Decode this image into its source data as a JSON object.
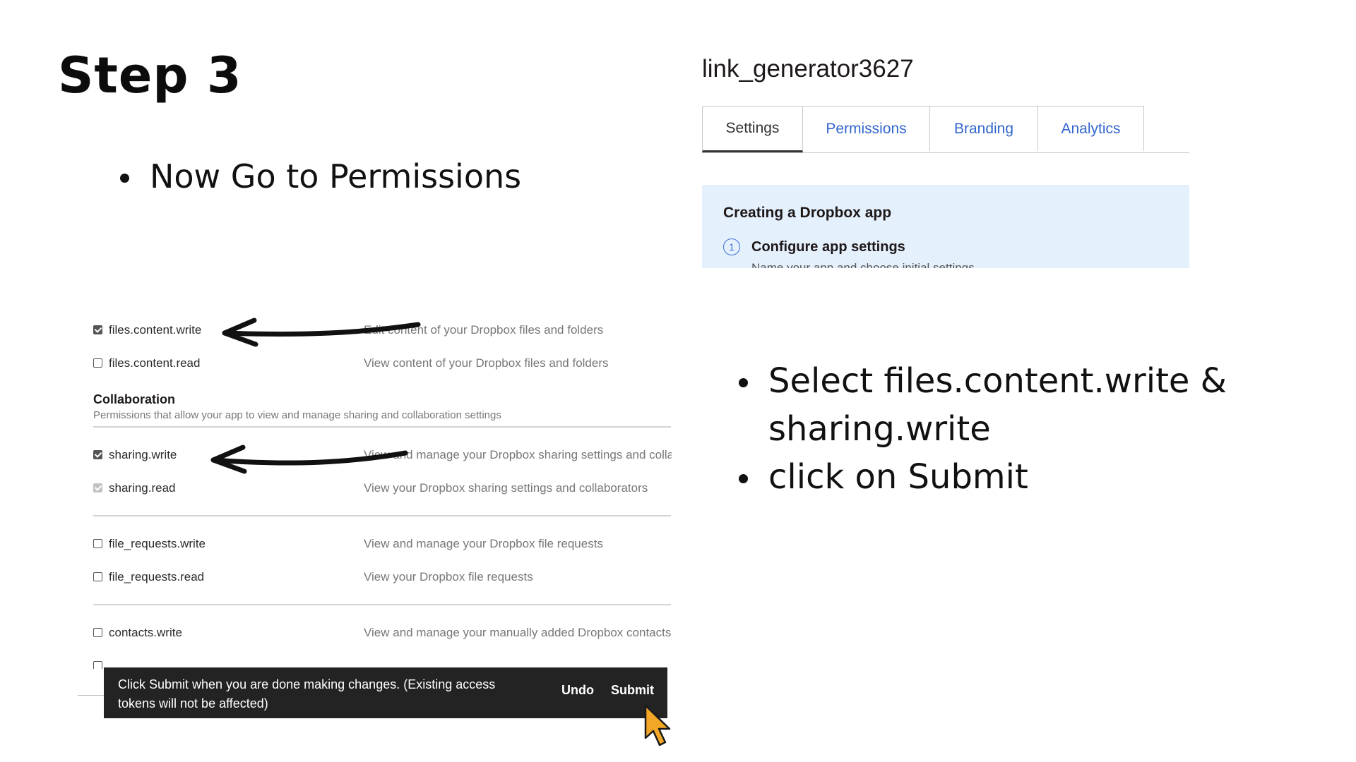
{
  "slide": {
    "title": "Step 3",
    "bullets_left": [
      "Now Go to Permissions"
    ],
    "bullets_right": [
      "Select files.content.write & sharing.write",
      "click on Submit"
    ]
  },
  "app": {
    "name": "link_generator3627",
    "tabs": [
      {
        "label": "Settings",
        "active": true
      },
      {
        "label": "Permissions",
        "active": false
      },
      {
        "label": "Branding",
        "active": false
      },
      {
        "label": "Analytics",
        "active": false
      }
    ],
    "info_box": {
      "title": "Creating a Dropbox app",
      "step_number": "1",
      "step_label": "Configure app settings",
      "step_desc": "Name your app and choose initial settings"
    }
  },
  "permissions": {
    "rows": [
      {
        "name": "files.content.write",
        "desc": "Edit content of your Dropbox files and folders",
        "checked": true,
        "disabled": false
      },
      {
        "name": "files.content.read",
        "desc": "View content of your Dropbox files and folders",
        "checked": false,
        "disabled": false
      },
      {
        "name": "sharing.write",
        "desc": "View and manage your Dropbox sharing settings and collaborators",
        "checked": true,
        "disabled": false
      },
      {
        "name": "sharing.read",
        "desc": "View your Dropbox sharing settings and collaborators",
        "checked": true,
        "disabled": true
      },
      {
        "name": "file_requests.write",
        "desc": "View and manage your Dropbox file requests",
        "checked": false,
        "disabled": false
      },
      {
        "name": "file_requests.read",
        "desc": "View your Dropbox file requests",
        "checked": false,
        "disabled": false
      },
      {
        "name": "contacts.write",
        "desc": "View and manage your manually added Dropbox contacts",
        "checked": false,
        "disabled": false
      }
    ],
    "collaboration": {
      "title": "Collaboration",
      "subtitle": "Permissions that allow your app to view and manage sharing and collaboration settings"
    },
    "toast": {
      "message": "Click Submit when you are done making changes. (Existing access tokens will not be affected)",
      "undo_label": "Undo",
      "submit_label": "Submit"
    }
  },
  "colors": {
    "tab_link": "#3366cc",
    "info_bg": "#e5f0fd",
    "toast_bg": "#232323",
    "cursor": "#f2a826"
  },
  "icons": [
    "arrow-annotation-icon",
    "mouse-pointer-icon",
    "checkbox-icon"
  ]
}
